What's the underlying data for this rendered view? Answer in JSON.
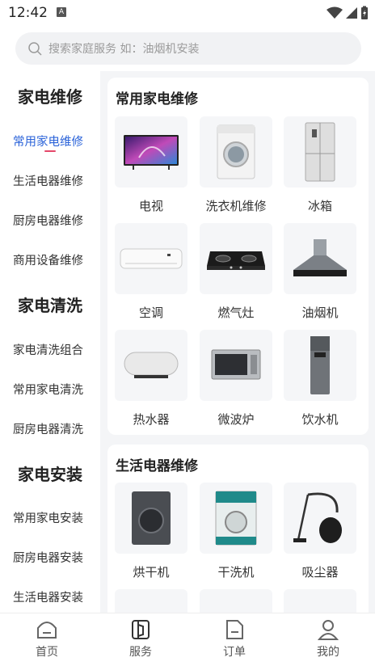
{
  "status_bar": {
    "time": "12:42",
    "notif_letter": "A"
  },
  "search": {
    "placeholder": "搜索家庭服务 如：油烟机安装"
  },
  "sidebar": {
    "cat_repair": "家电维修",
    "cat_clean": "家电清洗",
    "cat_install": "家电安装",
    "items": {
      "common_repair": "常用家电维修",
      "life_repair": "生活电器维修",
      "kitchen_repair": "厨房电器维修",
      "commercial_repair": "商用设备维修",
      "clean_combo": "家电清洗组合",
      "common_clean": "常用家电清洗",
      "kitchen_clean": "厨房电器清洗",
      "common_install": "常用家电安装",
      "kitchen_install": "厨房电器安装",
      "life_install": "生活电器安装"
    },
    "accent": "#2b63d9",
    "underline_color": "#e5476a"
  },
  "sections": {
    "common": {
      "title": "常用家电维修",
      "items": [
        "电视",
        "洗衣机维修",
        "冰箱",
        "空调",
        "燃气灶",
        "油烟机",
        "热水器",
        "微波炉",
        "饮水机"
      ]
    },
    "life": {
      "title": "生活电器维修",
      "items": [
        "烘干机",
        "干洗机",
        "吸尘器"
      ]
    }
  },
  "tabbar": {
    "home": "首页",
    "service": "服务",
    "orders": "订单",
    "mine": "我的"
  }
}
